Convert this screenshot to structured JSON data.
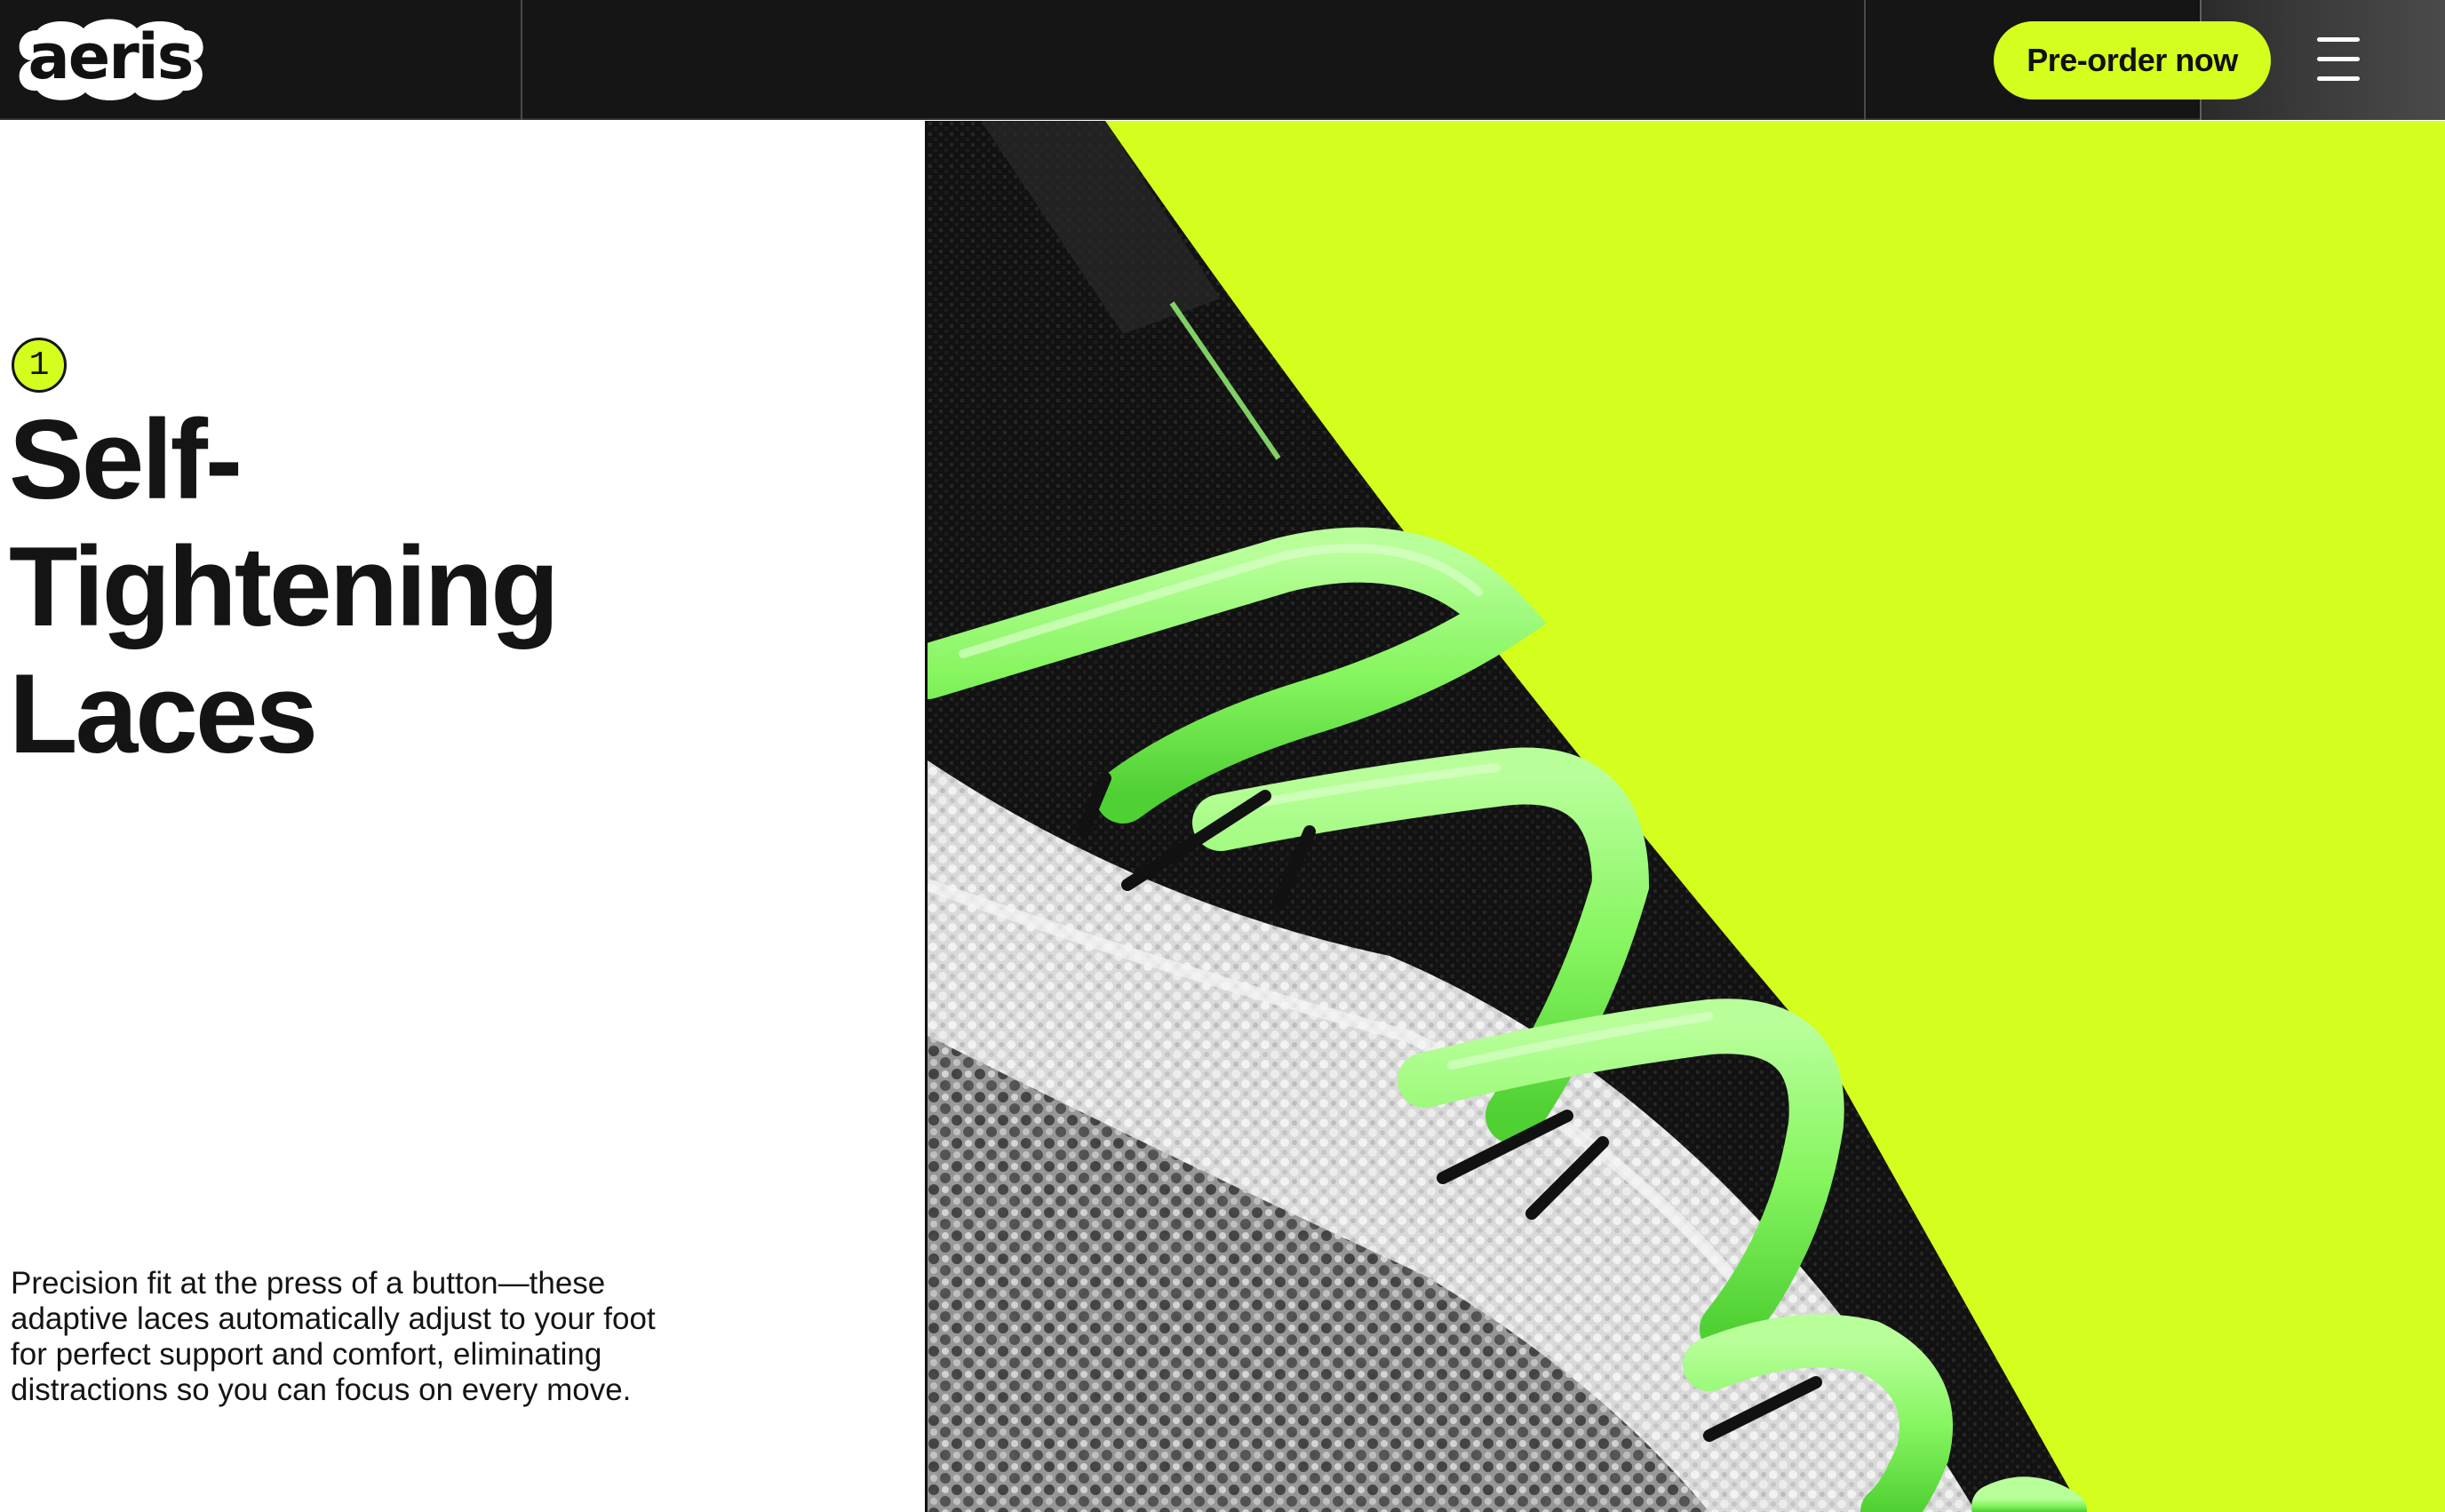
{
  "brand": {
    "logo_text": "aeris"
  },
  "header": {
    "cta_label": "Pre-order now",
    "menu_icon": "hamburger-menu-icon"
  },
  "feature": {
    "number": "1",
    "title_lines": [
      "Self-",
      "Tightening",
      "Laces"
    ],
    "description_lines": [
      "Precision fit at the press of a button—these",
      "adaptive laces automatically adjust to your foot",
      "for perfect support and comfort, eliminating",
      "distractions so you can focus on every move."
    ]
  },
  "colors": {
    "accent": "#d4ff1e",
    "header_bg": "#151515",
    "text": "#141414",
    "lace_green": "#8dff6a"
  }
}
